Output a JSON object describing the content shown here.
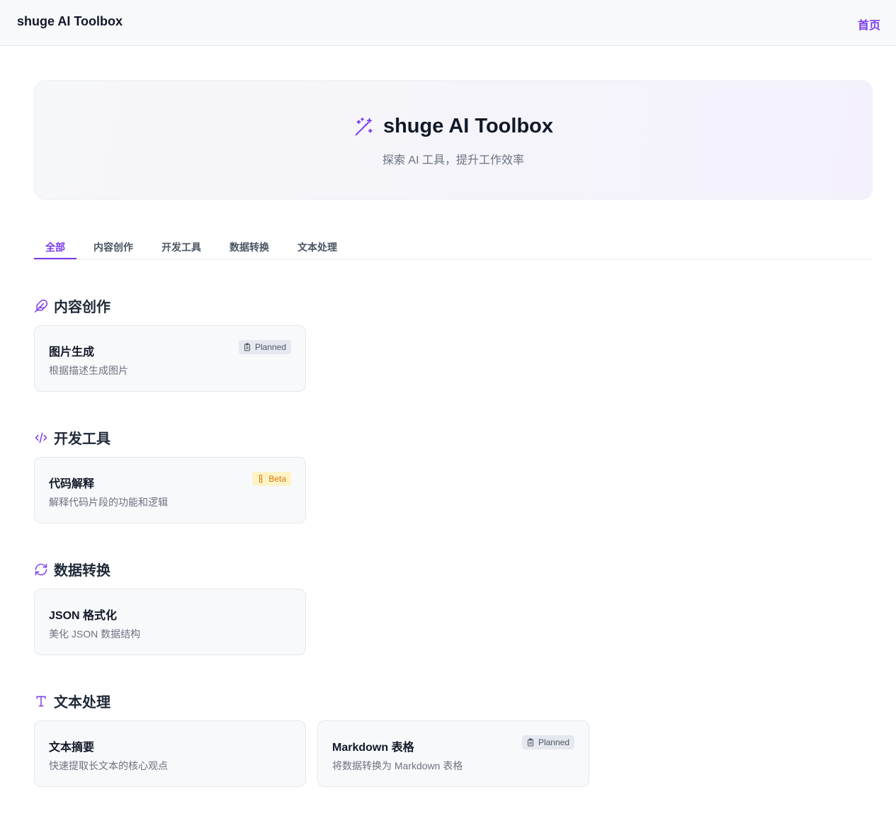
{
  "topbar": {
    "brand": "shuge AI Toolbox",
    "home_link": "首页"
  },
  "hero": {
    "icon": "magic-wand-icon",
    "title": "shuge AI Toolbox",
    "subtitle": "探索 AI 工具，提升工作效率"
  },
  "tabs": [
    {
      "label": "全部",
      "active": true
    },
    {
      "label": "内容创作",
      "active": false
    },
    {
      "label": "开发工具",
      "active": false
    },
    {
      "label": "数据转换",
      "active": false
    },
    {
      "label": "文本处理",
      "active": false
    }
  ],
  "colors": {
    "accent": "#7c3aed",
    "planned_bg": "#e5e8ee",
    "beta_bg": "#fef3c7",
    "beta_text": "#d97706"
  },
  "sections": [
    {
      "title": "内容创作",
      "icon": "feather-icon",
      "tools": [
        {
          "title": "图片生成",
          "description": "根据描述生成图片",
          "badge": {
            "label": "Planned",
            "icon": "clipboard-icon"
          }
        }
      ]
    },
    {
      "title": "开发工具",
      "icon": "code-icon",
      "tools": [
        {
          "title": "代码解释",
          "description": "解释代码片段的功能和逻辑",
          "badge": {
            "label": "Beta",
            "icon": "flask-icon"
          }
        }
      ]
    },
    {
      "title": "数据转换",
      "icon": "refresh-icon",
      "tools": [
        {
          "title": "JSON 格式化",
          "description": "美化 JSON 数据结构"
        }
      ]
    },
    {
      "title": "文本处理",
      "icon": "text-type-icon",
      "tools": [
        {
          "title": "文本摘要",
          "description": "快速提取长文本的核心观点"
        },
        {
          "title": "Markdown 表格",
          "description": "将数据转换为 Markdown 表格",
          "badge": {
            "label": "Planned",
            "icon": "clipboard-icon"
          }
        }
      ]
    }
  ]
}
